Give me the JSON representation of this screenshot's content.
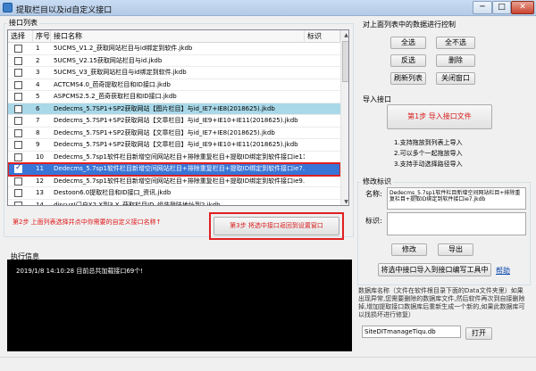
{
  "window": {
    "title": "提取栏目以及id自定义接口",
    "min": "─",
    "max": "□",
    "close": "✕"
  },
  "list_group": {
    "label": "接口列表"
  },
  "table": {
    "headers": [
      "选择",
      "序号",
      "接口名称",
      "标识"
    ],
    "rows": [
      {
        "checked": false,
        "no": "1",
        "name": "5UCMS_V1.2_获取网站栏目与id绑定到软件.jkdb",
        "tag": ""
      },
      {
        "checked": false,
        "no": "2",
        "name": "5UCMS_V2.15获取网站栏目与id.jkdb",
        "tag": ""
      },
      {
        "checked": false,
        "no": "3",
        "name": "5UCMS_V3_获取网站栏目与id绑定到软件.jkdb",
        "tag": ""
      },
      {
        "checked": false,
        "no": "4",
        "name": "ACTCMS4.0_芭奇提取栏目和ID接口.jkdb",
        "tag": ""
      },
      {
        "checked": false,
        "no": "5",
        "name": "ASPCMS2.5.2_芭奇获取栏目和ID接口.jkdb",
        "tag": ""
      },
      {
        "checked": false,
        "no": "6",
        "name": "Dedecms_5.7SP1+SP2获取网站【图片栏目】与id_IE7+IE8(2018625).jkdb",
        "tag": ""
      },
      {
        "checked": false,
        "no": "7",
        "name": "Dedecms_5.7SP1+SP2获取网站【文章栏目】与id_IE9+IE10+IE11(2018625).jkdb",
        "tag": ""
      },
      {
        "checked": false,
        "no": "8",
        "name": "Dedecms_5.7SP1+SP2获取网站【文章栏目】与id_IE7+IE8(2018625).jkdb",
        "tag": ""
      },
      {
        "checked": false,
        "no": "9",
        "name": "Dedecms_5.7SP1+SP2获取网站【文章栏目】与id_IE9+IE10+IE11(2018625).jkdb",
        "tag": ""
      },
      {
        "checked": false,
        "no": "10",
        "name": "Dedecms_5.7sp1软件栏目新增空间网站栏目+排除重复栏目+提取ID绑定到软件接口ie11.jkdb",
        "tag": ""
      },
      {
        "checked": true,
        "no": "11",
        "name": "Dedecms_5.7sp1软件栏目新增空间网站栏目+排除重复栏目+提取ID绑定到软件接口ie7.jkdb",
        "tag": ""
      },
      {
        "checked": false,
        "no": "12",
        "name": "Dedecms_5.7sp1软件栏目新增空间网站栏目+排除重复栏目+提取ID绑定到软件接口ie9.jkdb",
        "tag": ""
      },
      {
        "checked": false,
        "no": "13",
        "name": "Destoon6.0提取栏目和ID接口_资讯.jkdb",
        "tag": ""
      },
      {
        "checked": false,
        "no": "14",
        "name": "discuz!门户X2.X到3.X_获取栏目ID_组装登陆地址到2.jkdb",
        "tag": ""
      },
      {
        "checked": false,
        "no": "15",
        "name": "discuzV7.2_芭奇获取新闻栏目与id接口_通用2.jkdb",
        "tag": ""
      }
    ]
  },
  "step2_text": "第2步 上面列表选择并点中你需要的自定义接口名称↑",
  "step3_button": "第3步 将选中接口返回到设置窗口",
  "log": {
    "label": "执行信息",
    "lines": [
      "2019/1/8 14:10:28   目前总共加载接口69个!"
    ]
  },
  "control": {
    "label": "对上面列表中的数据进行控制",
    "buttons": [
      "全选",
      "全不选",
      "反选",
      "删除",
      "刷新列表",
      "关闭窗口"
    ]
  },
  "import": {
    "label": "导入接口",
    "step1_button": "第1步 导入接口文件",
    "instructions": [
      "1.支持拖放到列表上导入",
      "2.可以多个一起拖放导入",
      "3.支持手动选择路径导入"
    ]
  },
  "edit": {
    "label": "修改标识",
    "name_label": "名称:",
    "name_value": "Dedecms_5.7sp1软件栏目新增空间网站栏目+排除重复栏目+提取ID绑定到软件接口ie7.jkdb",
    "tag_label": "标识:",
    "tag_value": "",
    "modify_button": "修改",
    "export_button": "导出",
    "import_to_tool_button": "将选中接口导入到接口编写工具中",
    "help_link": "帮助"
  },
  "description": "数据库名称（文件在软件根目录下面的Data文件夹里）如果出现异常,您需要删除的数据库文件,然后软件再次到自接删除掉,增加提取接口数据库后重新生成一个新的,如果此数据库可以找损坏进行修复）",
  "db": {
    "file": "SiteDITmanageTiqu.db",
    "open_button": "打开"
  },
  "colors": {
    "highlight": "#a9d8e8",
    "selected": "#3875d7",
    "red": "#e02020",
    "console_bg": "#000000"
  }
}
